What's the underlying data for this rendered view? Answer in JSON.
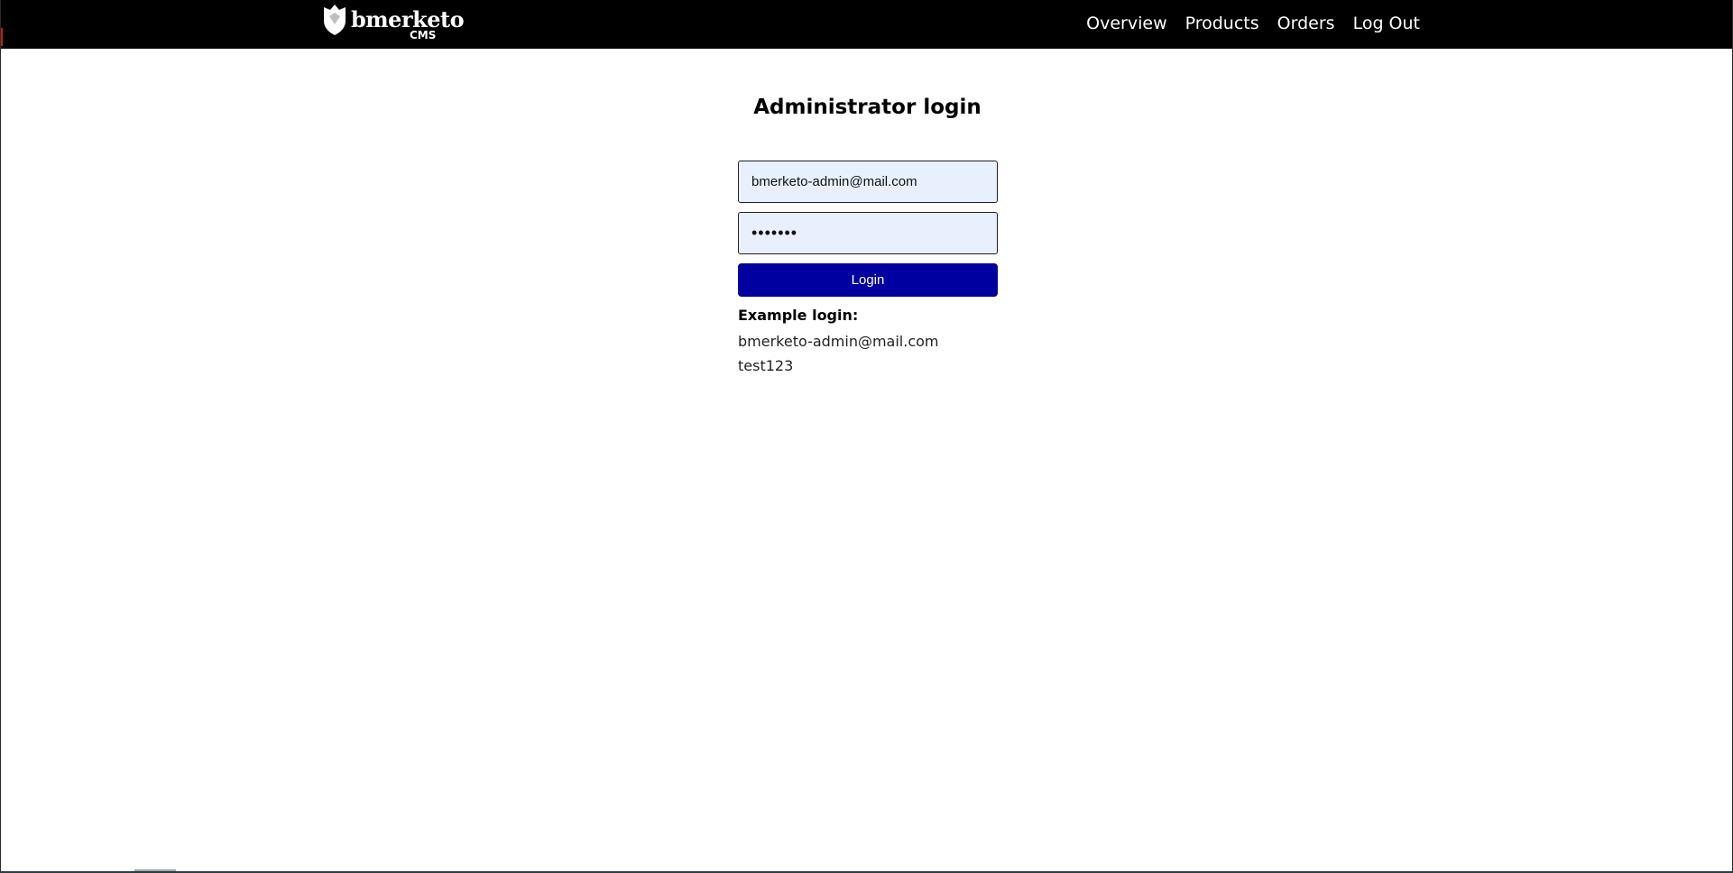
{
  "header": {
    "brand_name": "bmerketo",
    "brand_sub": "CMS",
    "nav": [
      {
        "label": "Overview"
      },
      {
        "label": "Products"
      },
      {
        "label": "Orders"
      },
      {
        "label": "Log Out"
      }
    ]
  },
  "main": {
    "title": "Administrator login",
    "form": {
      "email_value": "bmerketo-admin@mail.com",
      "password_value": "•••••••",
      "submit_label": "Login"
    },
    "example": {
      "title": "Example login:",
      "email": "bmerketo-admin@mail.com",
      "password": "test123"
    }
  },
  "colors": {
    "navbar": "#000000",
    "button": "#0000a0",
    "input_bg": "#e8f0fe"
  },
  "icons": {
    "logo": "shield-logo-icon"
  }
}
